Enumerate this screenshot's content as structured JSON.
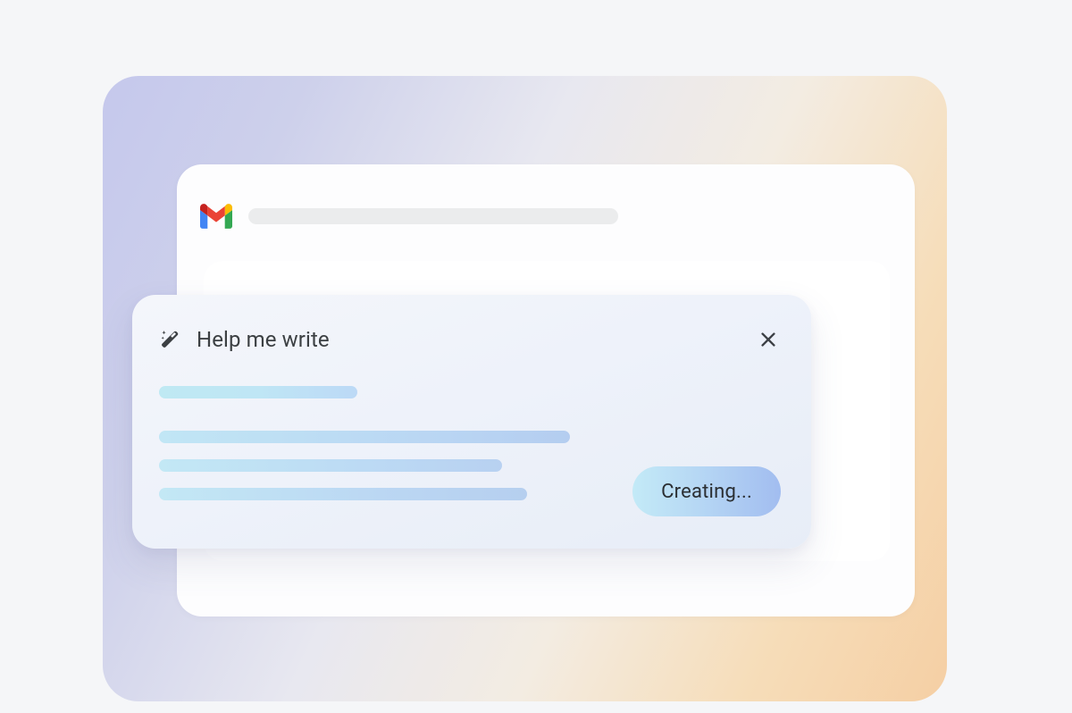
{
  "app": {
    "name": "gmail"
  },
  "card": {
    "title": "Help me write",
    "status_label": "Creating..."
  }
}
